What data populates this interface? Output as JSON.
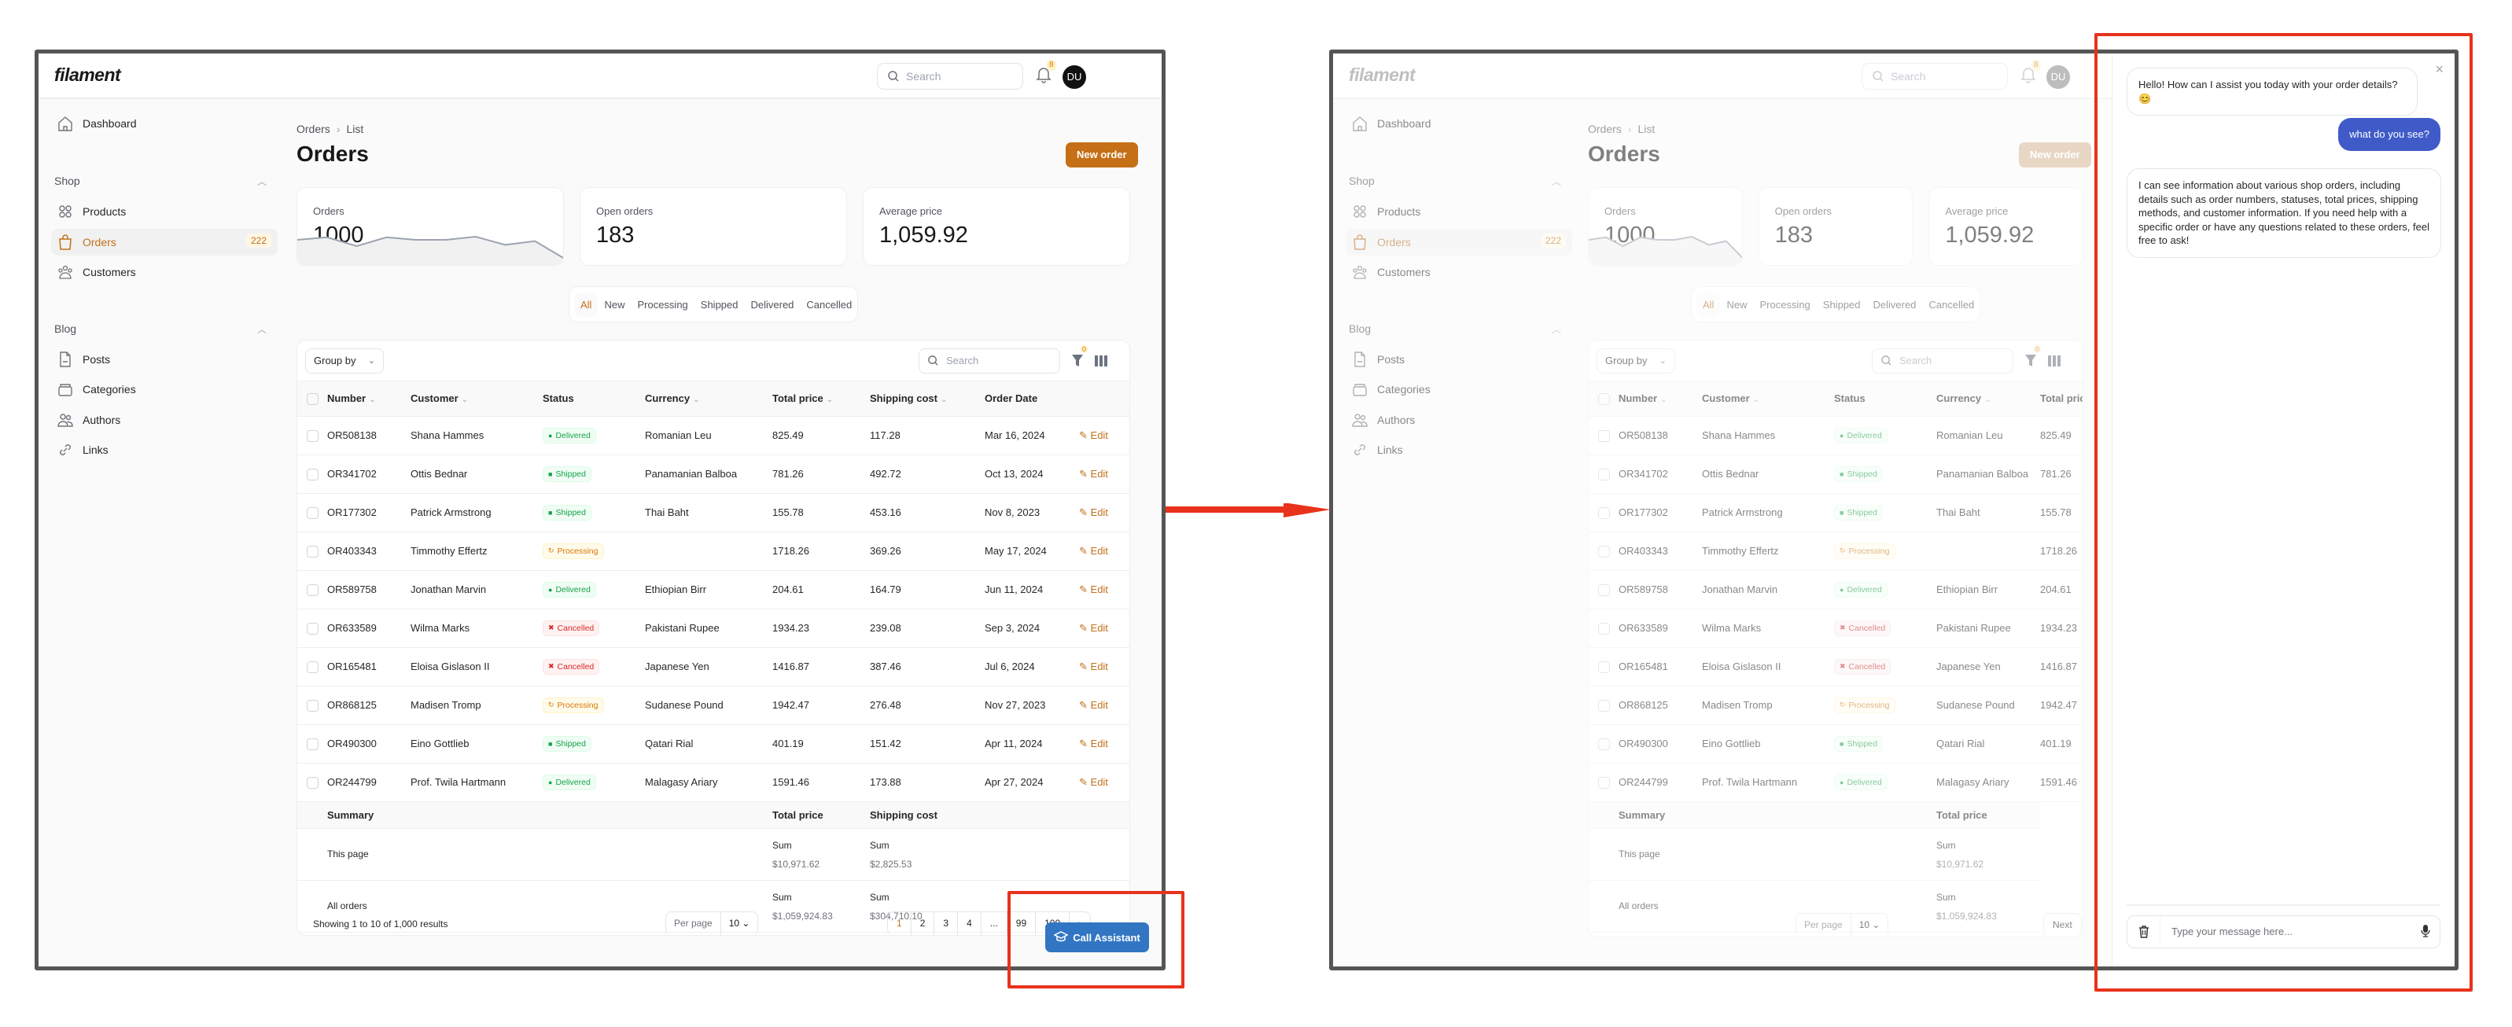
{
  "app": {
    "logo": "filament",
    "search_placeholder": "Search",
    "notification_count": "8",
    "avatar_initials": "DU"
  },
  "sidebar": {
    "dashboard": "Dashboard",
    "groups": [
      {
        "label": "Shop",
        "items": [
          {
            "label": "Products",
            "icon": "products-icon"
          },
          {
            "label": "Orders",
            "icon": "shopping-bag-icon",
            "badge": "222",
            "active": true
          },
          {
            "label": "Customers",
            "icon": "customers-icon"
          }
        ]
      },
      {
        "label": "Blog",
        "items": [
          {
            "label": "Posts",
            "icon": "document-icon"
          },
          {
            "label": "Categories",
            "icon": "folder-icon"
          },
          {
            "label": "Authors",
            "icon": "users-icon"
          },
          {
            "label": "Links",
            "icon": "link-icon"
          }
        ]
      }
    ]
  },
  "page": {
    "breadcrumb": [
      "Orders",
      "List"
    ],
    "title": "Orders",
    "new_button": "New order"
  },
  "stats": [
    {
      "label": "Orders",
      "value": "1000",
      "sparkline": [
        40,
        44,
        30,
        44,
        40,
        40,
        45,
        32,
        38,
        10
      ]
    },
    {
      "label": "Open orders",
      "value": "183"
    },
    {
      "label": "Average price",
      "value": "1,059.92"
    }
  ],
  "tabs": [
    "All",
    "New",
    "Processing",
    "Shipped",
    "Delivered",
    "Cancelled"
  ],
  "active_tab": "All",
  "table": {
    "group_by": "Group by",
    "search_placeholder": "Search",
    "filter_count": "0",
    "columns": [
      "Number",
      "Customer",
      "Status",
      "Currency",
      "Total price",
      "Shipping cost",
      "Order Date"
    ],
    "edit_label": "Edit",
    "rows": [
      {
        "number": "OR508138",
        "customer": "Shana Hammes",
        "status": "Delivered",
        "currency": "Romanian Leu",
        "total": "825.49",
        "shipping": "117.28",
        "date": "Mar 16, 2024"
      },
      {
        "number": "OR341702",
        "customer": "Ottis Bednar",
        "status": "Shipped",
        "currency": "Panamanian Balboa",
        "total": "781.26",
        "shipping": "492.72",
        "date": "Oct 13, 2024"
      },
      {
        "number": "OR177302",
        "customer": "Patrick Armstrong",
        "status": "Shipped",
        "currency": "Thai Baht",
        "total": "155.78",
        "shipping": "453.16",
        "date": "Nov 8, 2023"
      },
      {
        "number": "OR403343",
        "customer": "Timmothy Effertz",
        "status": "Processing",
        "currency": "",
        "total": "1718.26",
        "shipping": "369.26",
        "date": "May 17, 2024"
      },
      {
        "number": "OR589758",
        "customer": "Jonathan Marvin",
        "status": "Delivered",
        "currency": "Ethiopian Birr",
        "total": "204.61",
        "shipping": "164.79",
        "date": "Jun 11, 2024"
      },
      {
        "number": "OR633589",
        "customer": "Wilma Marks",
        "status": "Cancelled",
        "currency": "Pakistani Rupee",
        "total": "1934.23",
        "shipping": "239.08",
        "date": "Sep 3, 2024"
      },
      {
        "number": "OR165481",
        "customer": "Eloisa Gislason II",
        "status": "Cancelled",
        "currency": "Japanese Yen",
        "total": "1416.87",
        "shipping": "387.46",
        "date": "Jul 6, 2024"
      },
      {
        "number": "OR868125",
        "customer": "Madisen Tromp",
        "status": "Processing",
        "currency": "Sudanese Pound",
        "total": "1942.47",
        "shipping": "276.48",
        "date": "Nov 27, 2023"
      },
      {
        "number": "OR490300",
        "customer": "Eino Gottlieb",
        "status": "Shipped",
        "currency": "Qatari Rial",
        "total": "401.19",
        "shipping": "151.42",
        "date": "Apr 11, 2024"
      },
      {
        "number": "OR244799",
        "customer": "Prof. Twila Hartmann",
        "status": "Delivered",
        "currency": "Malagasy Ariary",
        "total": "1591.46",
        "shipping": "173.88",
        "date": "Apr 27, 2024"
      }
    ],
    "summary": {
      "label": "Summary",
      "total_col": "Total price",
      "shipping_col": "Shipping cost",
      "sum_label": "Sum",
      "this_page": {
        "label": "This page",
        "total": "$10,971.62",
        "shipping": "$2,825.53"
      },
      "all": {
        "label": "All orders",
        "total": "$1,059,924.83",
        "shipping": "$304,710.10"
      }
    },
    "showing": "Showing 1 to 10 of 1,000 results",
    "per_page_label": "Per page",
    "per_page": "10",
    "pages": [
      "1",
      "2",
      "3",
      "4",
      "...",
      "99",
      "100",
      "›"
    ],
    "current_page": "1",
    "next_label": "Next"
  },
  "assistant": {
    "call_button": "Call Assistant",
    "messages": [
      {
        "role": "assistant",
        "text": "Hello! How can I assist you today with your order details? 😊"
      },
      {
        "role": "user",
        "text": "what do you see?"
      },
      {
        "role": "assistant",
        "text": "I can see information about various shop orders, including details such as order numbers, statuses, total prices, shipping methods, and customer information. If you need help with a specific order or have any questions related to these orders, feel free to ask!"
      }
    ],
    "input_placeholder": "Type your message here..."
  },
  "colors": {
    "primary": "#c56f16",
    "assistant_button": "#3276c3",
    "user_bubble": "#3b5bdb",
    "annotation": "#e8321b"
  }
}
